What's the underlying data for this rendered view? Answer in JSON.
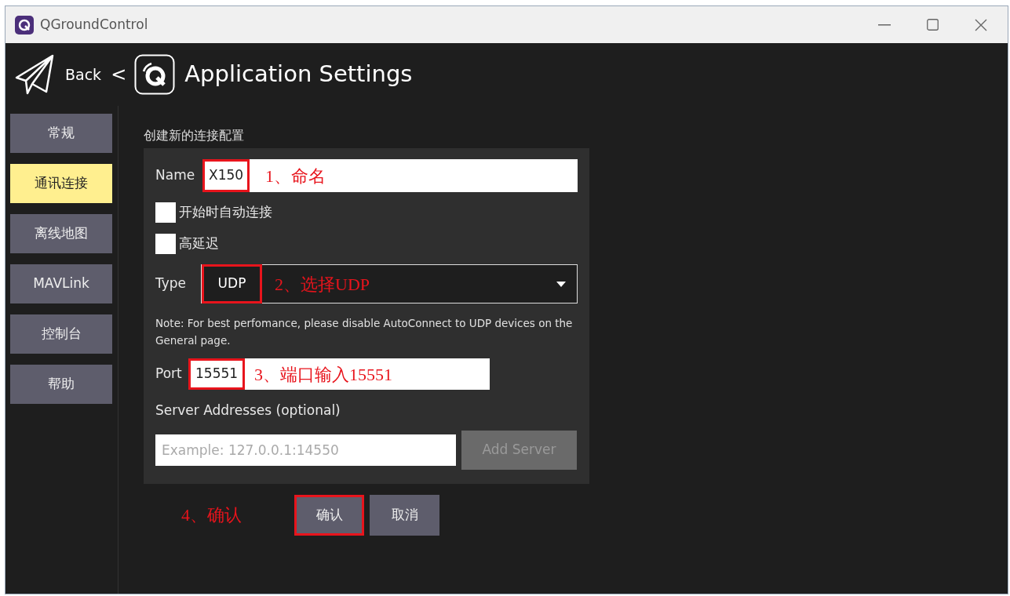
{
  "window": {
    "title": "QGroundControl"
  },
  "header": {
    "back": "Back",
    "separator": "<",
    "title": "Application Settings"
  },
  "sidebar": {
    "items": [
      {
        "label": "常规",
        "selected": false
      },
      {
        "label": "通讯连接",
        "selected": true
      },
      {
        "label": "离线地图",
        "selected": false
      },
      {
        "label": "MAVLink",
        "selected": false
      },
      {
        "label": "控制台",
        "selected": false
      },
      {
        "label": "帮助",
        "selected": false
      }
    ]
  },
  "form": {
    "heading": "创建新的连接配置",
    "name": {
      "label": "Name",
      "value": "X150",
      "highlighted": true,
      "annotation": "1、命名"
    },
    "options": [
      {
        "label": "开始时自动连接",
        "checked": false
      },
      {
        "label": "高延迟",
        "checked": false
      }
    ],
    "type": {
      "label": "Type",
      "value": "UDP",
      "highlighted": true,
      "annotation": "2、选择UDP"
    },
    "note": "Note: For best perfomance, please disable AutoConnect to UDP devices on the General page.",
    "port": {
      "label": "Port",
      "value": "15551",
      "highlighted": true,
      "annotation": "3、端口输入15551"
    },
    "server": {
      "label": "Server Addresses (optional)",
      "placeholder": "Example: 127.0.0.1:14550",
      "button": "Add Server",
      "disabled": true
    }
  },
  "actions": [
    {
      "label": "确认",
      "highlighted": true
    },
    {
      "label": "取消",
      "highlighted": false
    }
  ],
  "action_annotation": "4、确认"
}
